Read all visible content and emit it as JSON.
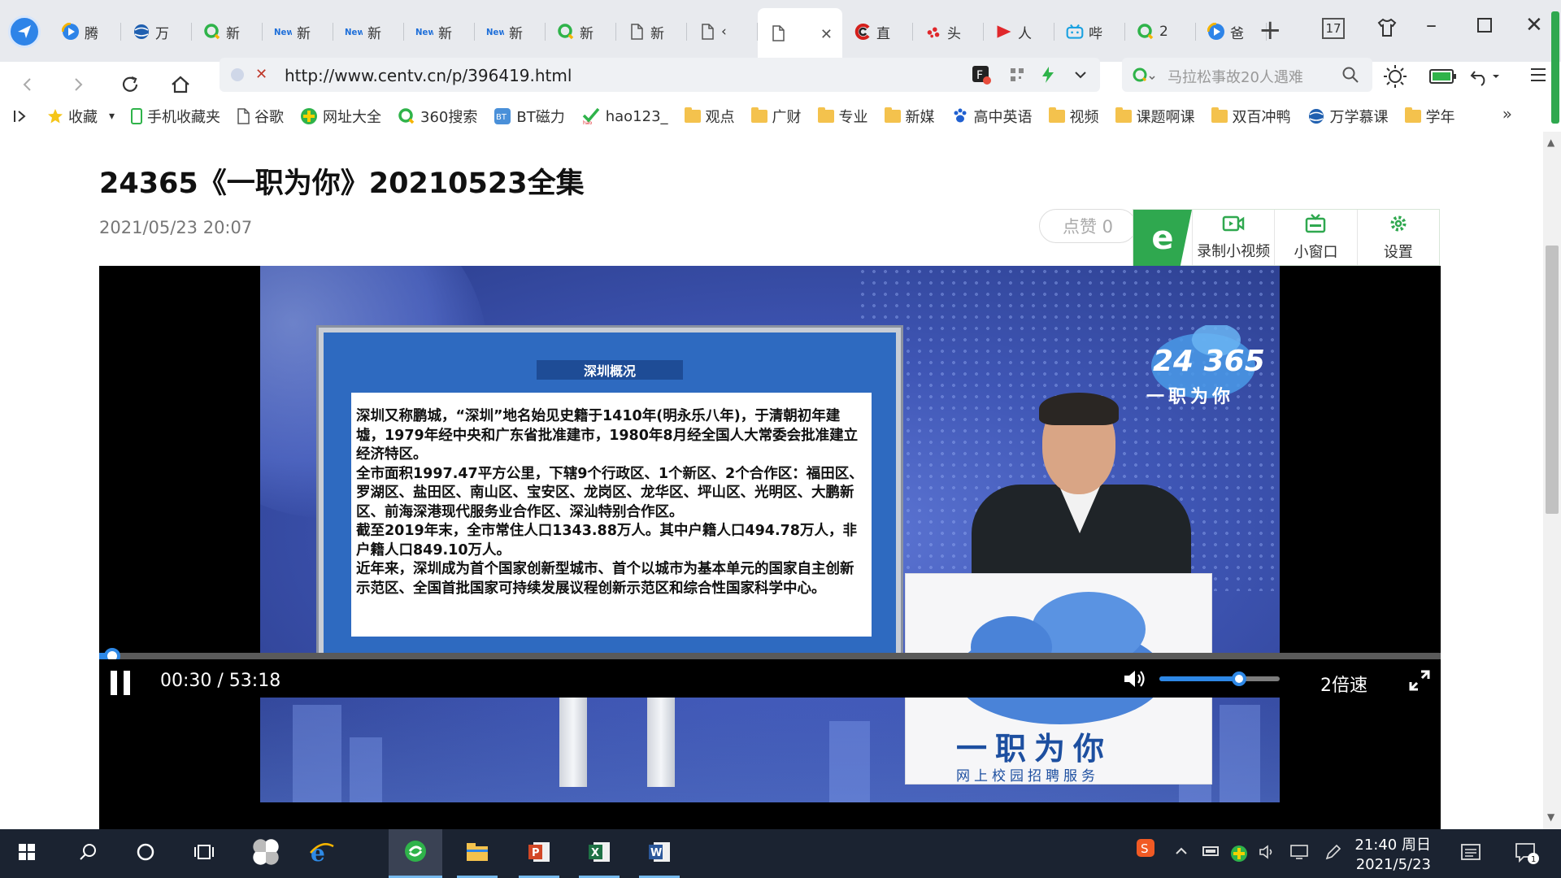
{
  "browser": {
    "tabs": [
      {
        "icon": "video-play-icon",
        "label": "腾"
      },
      {
        "icon": "globe-icon",
        "label": "万"
      },
      {
        "icon": "search360-icon",
        "label": "新"
      },
      {
        "icon": "news-icon",
        "label": "新"
      },
      {
        "icon": "news-icon",
        "label": "新"
      },
      {
        "icon": "news-icon",
        "label": "新"
      },
      {
        "icon": "news-icon",
        "label": "新"
      },
      {
        "icon": "search360-icon",
        "label": "新"
      },
      {
        "icon": "page-icon",
        "label": "新"
      },
      {
        "icon": "page-icon",
        "label": "‹"
      },
      {
        "icon": "page-icon",
        "label": "",
        "active": true
      },
      {
        "icon": "cctv-icon",
        "label": "直"
      },
      {
        "icon": "weibo-icon",
        "label": "头"
      },
      {
        "icon": "youtube-icon",
        "label": "人"
      },
      {
        "icon": "bilibili-icon",
        "label": "哔"
      },
      {
        "icon": "search360-icon",
        "label": "2"
      },
      {
        "icon": "video-play-icon",
        "label": "爸"
      }
    ],
    "tab_count": "17",
    "url": "http://www.centv.cn/p/396419.html",
    "search_placeholder": "马拉松事故20人遇难",
    "bookmarks": [
      {
        "icon": "star-icon",
        "label": "收藏"
      },
      {
        "icon": "phone-icon",
        "label": "手机收藏夹"
      },
      {
        "icon": "page-icon",
        "label": "谷歌"
      },
      {
        "icon": "plus-globe-icon",
        "label": "网址大全"
      },
      {
        "icon": "search360-icon",
        "label": "360搜索"
      },
      {
        "icon": "bt-icon",
        "label": "BT磁力"
      },
      {
        "icon": "hao-icon",
        "label": "hao123_"
      },
      {
        "icon": "folder-icon",
        "label": "观点"
      },
      {
        "icon": "folder-icon",
        "label": "广财"
      },
      {
        "icon": "folder-icon",
        "label": "专业"
      },
      {
        "icon": "folder-icon",
        "label": "新媒"
      },
      {
        "icon": "paw-icon",
        "label": "高中英语"
      },
      {
        "icon": "folder-icon",
        "label": "视频"
      },
      {
        "icon": "folder-icon",
        "label": "课题啊课"
      },
      {
        "icon": "folder-icon",
        "label": "双百冲鸭"
      },
      {
        "icon": "globe-icon",
        "label": "万学慕课"
      },
      {
        "icon": "folder-icon",
        "label": "学年"
      }
    ],
    "more_bookmarks": "»"
  },
  "article": {
    "title": "24365《一职为你》20210523全集",
    "date": "2021/05/23 20:07",
    "like_label": "点赞 0"
  },
  "extension": {
    "logo": "e",
    "items": [
      {
        "icon": "record-icon",
        "label": "录制小视频"
      },
      {
        "icon": "mini-window-icon",
        "label": "小窗口"
      },
      {
        "icon": "gear-icon",
        "label": "设置"
      }
    ]
  },
  "video": {
    "board_title": "深圳概况",
    "board_paragraphs": [
      "深圳又称鹏城，“深圳”地名始见史籍于1410年(明永乐八年)，于清朝初年建墟，1979年经中央和广东省批准建市，1980年8月经全国人大常委会批准建立经济特区。",
      "全市面积1997.47平方公里，下辖9个行政区、1个新区、2个合作区：福田区、罗湖区、盐田区、南山区、宝安区、龙岗区、龙华区、坪山区、光明区、大鹏新区、前海深港现代服务业合作区、深汕特别合作区。",
      "截至2019年末，全市常住人口1343.88万人。其中户籍人口494.78万人，非户籍人口849.10万人。",
      "近年来，深圳成为首个国家创新型城市、首个以城市为基本单元的国家自主创新示范区、全国首批国家可持续发展议程创新示范区和综合性国家科学中心。"
    ],
    "logo_number": "24 365",
    "logo_slogan": "一职为你",
    "logo_subtitle": "网上校园招聘服务",
    "time_display": "00:30 / 53:18",
    "progress_fraction": 0.0094,
    "volume_fraction": 0.66,
    "speed_label": "2倍速"
  },
  "taskbar": {
    "apps": [
      {
        "icon": "windows-start-icon"
      },
      {
        "icon": "search-icon"
      },
      {
        "icon": "cortana-icon"
      },
      {
        "icon": "task-view-icon"
      },
      {
        "icon": "pinwheel-icon"
      },
      {
        "icon": "ie-icon"
      },
      {
        "icon": "browser-360-icon",
        "active": true
      },
      {
        "icon": "file-explorer-icon"
      },
      {
        "icon": "powerpoint-icon"
      },
      {
        "icon": "excel-icon"
      },
      {
        "icon": "word-icon"
      }
    ],
    "clock_time": "21:40 周日",
    "clock_date": "2021/5/23",
    "notification_count": "1"
  },
  "colors": {
    "accent": "#2e88e6",
    "extension_green": "#2fa84f",
    "taskbar": "#1b2331"
  }
}
